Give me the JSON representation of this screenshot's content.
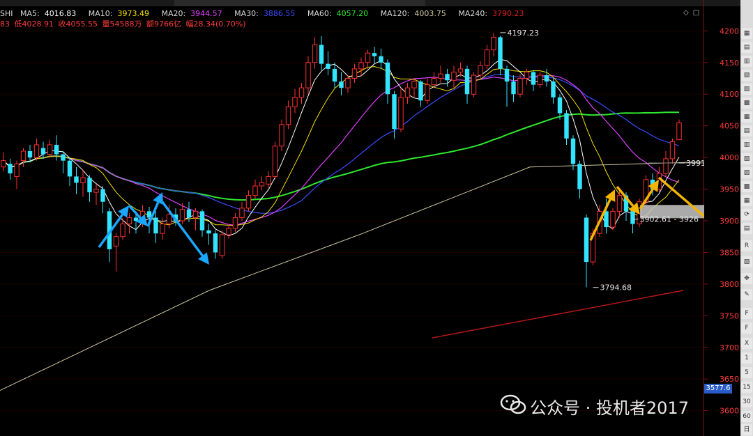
{
  "header": {
    "symbol": "SHI",
    "ma": [
      {
        "label": "MA5:",
        "value": "4016.83",
        "color": "#ffffff"
      },
      {
        "label": "MA10:",
        "value": "3973.49",
        "color": "#f5e000"
      },
      {
        "label": "MA20:",
        "value": "3944.57",
        "color": "#e040ff"
      },
      {
        "label": "MA30:",
        "value": "3886.55",
        "color": "#3a4cff"
      },
      {
        "label": "MA60:",
        "value": "4057.20",
        "color": "#2ee82e"
      },
      {
        "label": "MA120:",
        "value": "4003.75",
        "color": "#cfc6a0"
      },
      {
        "label": "MA240:",
        "value": "3790.23",
        "color": "#e02020"
      }
    ],
    "row2": [
      {
        "text": "83",
        "color": "#ff3b3b"
      },
      {
        "text": "低4028.91",
        "color": "#ff3b3b"
      },
      {
        "text": "收4055.55",
        "color": "#ff3b3b"
      },
      {
        "text": "量54588万",
        "color": "#ff3b3b"
      },
      {
        "text": "额9766亿",
        "color": "#ff3b3b"
      },
      {
        "text": "幅28.34(0.70%)",
        "color": "#ff3b3b"
      }
    ]
  },
  "watermark": "公众号 · 投机者2017",
  "current_price_tag": "3577.6",
  "right_panel": [
    "1",
    "5",
    "15",
    "30",
    "60",
    "日"
  ],
  "chart_data": {
    "type": "candlestick",
    "ylim": [
      3560,
      4240
    ],
    "y_ticks": [
      4200,
      4150,
      4100,
      4050,
      4000,
      3950,
      3900,
      3850,
      3800,
      3750,
      3700,
      3650,
      3600,
      3550
    ],
    "colors": {
      "up": "#ff3030",
      "down": "#33e4ff",
      "grid": "#8a1010",
      "axis_text": "#ff3b3b"
    },
    "candles": [
      [
        3985,
        3995,
        4008,
        3978
      ],
      [
        3990,
        3975,
        3998,
        3965
      ],
      [
        3970,
        3990,
        3995,
        3950
      ],
      [
        3995,
        4010,
        4015,
        3985
      ],
      [
        4010,
        4000,
        4020,
        3992
      ],
      [
        4000,
        4020,
        4030,
        3995
      ],
      [
        4015,
        4005,
        4025,
        3998
      ],
      [
        4005,
        4020,
        4028,
        4000
      ],
      [
        4020,
        4005,
        4035,
        3995
      ],
      [
        4005,
        3995,
        4010,
        3975
      ],
      [
        3995,
        3970,
        4000,
        3955
      ],
      [
        3970,
        3960,
        3985,
        3942
      ],
      [
        3960,
        3968,
        3980,
        3938
      ],
      [
        3968,
        3945,
        3972,
        3930
      ],
      [
        3945,
        3950,
        3958,
        3925
      ],
      [
        3950,
        3930,
        3955,
        3912
      ],
      [
        3915,
        3855,
        3920,
        3835
      ],
      [
        3860,
        3875,
        3880,
        3820
      ],
      [
        3875,
        3895,
        3905,
        3870
      ],
      [
        3895,
        3905,
        3912,
        3880
      ],
      [
        3905,
        3900,
        3915,
        3880
      ],
      [
        3898,
        3915,
        3925,
        3890
      ],
      [
        3915,
        3905,
        3922,
        3880
      ],
      [
        3905,
        3880,
        3915,
        3865
      ],
      [
        3880,
        3895,
        3905,
        3870
      ],
      [
        3895,
        3910,
        3925,
        3888
      ],
      [
        3910,
        3900,
        3920,
        3892
      ],
      [
        3900,
        3918,
        3928,
        3895
      ],
      [
        3918,
        3905,
        3930,
        3898
      ],
      [
        3905,
        3915,
        3920,
        3885
      ],
      [
        3915,
        3885,
        3918,
        3875
      ],
      [
        3885,
        3880,
        3895,
        3862
      ],
      [
        3880,
        3850,
        3885,
        3840
      ],
      [
        3845,
        3878,
        3885,
        3840
      ],
      [
        3878,
        3888,
        3895,
        3872
      ],
      [
        3888,
        3905,
        3912,
        3882
      ],
      [
        3905,
        3920,
        3930,
        3900
      ],
      [
        3920,
        3940,
        3948,
        3915
      ],
      [
        3940,
        3955,
        3965,
        3935
      ],
      [
        3955,
        3960,
        3970,
        3948
      ],
      [
        3958,
        3970,
        3978,
        3952
      ],
      [
        3970,
        4018,
        4025,
        3965
      ],
      [
        4018,
        4052,
        4060,
        4010
      ],
      [
        4052,
        4080,
        4090,
        4045
      ],
      [
        4080,
        4095,
        4108,
        4070
      ],
      [
        4095,
        4110,
        4118,
        4085
      ],
      [
        4110,
        4150,
        4160,
        4100
      ],
      [
        4150,
        4178,
        4190,
        4140
      ],
      [
        4178,
        4148,
        4192,
        4138
      ],
      [
        4148,
        4140,
        4168,
        4130
      ],
      [
        4140,
        4120,
        4150,
        4110
      ],
      [
        4120,
        4110,
        4135,
        4098
      ],
      [
        4110,
        4125,
        4130,
        4102
      ],
      [
        4125,
        4140,
        4148,
        4118
      ],
      [
        4140,
        4150,
        4158,
        4128
      ],
      [
        4150,
        4165,
        4170,
        4140
      ],
      [
        4165,
        4160,
        4175,
        4148
      ],
      [
        4160,
        4150,
        4172,
        4140
      ],
      [
        4150,
        4100,
        4155,
        4085
      ],
      [
        4100,
        4045,
        4105,
        4030
      ],
      [
        4045,
        4095,
        4110,
        4040
      ],
      [
        4095,
        4110,
        4118,
        4085
      ],
      [
        4110,
        4120,
        4125,
        4095
      ],
      [
        4120,
        4090,
        4122,
        4080
      ],
      [
        4090,
        4115,
        4125,
        4085
      ],
      [
        4115,
        4125,
        4135,
        4110
      ],
      [
        4125,
        4132,
        4145,
        4118
      ],
      [
        4132,
        4122,
        4140,
        4112
      ],
      [
        4122,
        4135,
        4145,
        4110
      ],
      [
        4135,
        4140,
        4150,
        4128
      ],
      [
        4140,
        4100,
        4145,
        4085
      ],
      [
        4100,
        4130,
        4135,
        4095
      ],
      [
        4130,
        4145,
        4152,
        4125
      ],
      [
        4145,
        4170,
        4178,
        4140
      ],
      [
        4170,
        4190,
        4197,
        4160
      ],
      [
        4190,
        4140,
        4192,
        4130
      ],
      [
        4140,
        4120,
        4145,
        4080
      ],
      [
        4120,
        4100,
        4130,
        4088
      ],
      [
        4100,
        4125,
        4132,
        4095
      ],
      [
        4125,
        4135,
        4140,
        4115
      ],
      [
        4135,
        4115,
        4138,
        4105
      ],
      [
        4115,
        4130,
        4135,
        4110
      ],
      [
        4130,
        4120,
        4140,
        4112
      ],
      [
        4120,
        4095,
        4125,
        4085
      ],
      [
        4095,
        4070,
        4100,
        4060
      ],
      [
        4070,
        4030,
        4075,
        4020
      ],
      [
        4030,
        3990,
        4035,
        3980
      ],
      [
        3990,
        3950,
        3995,
        3935
      ],
      [
        3905,
        3835,
        3910,
        3795
      ],
      [
        3835,
        3880,
        3888,
        3830
      ],
      [
        3880,
        3915,
        3925,
        3875
      ],
      [
        3915,
        3890,
        3935,
        3880
      ],
      [
        3890,
        3915,
        3920,
        3885
      ],
      [
        3915,
        3940,
        3948,
        3905
      ],
      [
        3940,
        3915,
        3945,
        3900
      ],
      [
        3915,
        3895,
        3925,
        3880
      ],
      [
        3895,
        3930,
        3935,
        3890
      ],
      [
        3930,
        3965,
        3972,
        3922
      ],
      [
        3965,
        3950,
        3975,
        3940
      ],
      [
        3950,
        3975,
        3985,
        3945
      ],
      [
        3975,
        3998,
        4010,
        3970
      ],
      [
        3998,
        4025,
        4030,
        3990
      ],
      [
        4028,
        4055,
        4060,
        4028
      ]
    ],
    "annotations": [
      {
        "text": "4197.23",
        "x": 75,
        "y": 4197.23
      },
      {
        "text": "3794.68",
        "x": 89,
        "y": 3794.68
      },
      {
        "text": "3991.26 -",
        "x": 102,
        "y": 3991.26
      },
      {
        "text": "3902.61 - 3926",
        "x": 95,
        "y": 3902.61
      }
    ]
  }
}
